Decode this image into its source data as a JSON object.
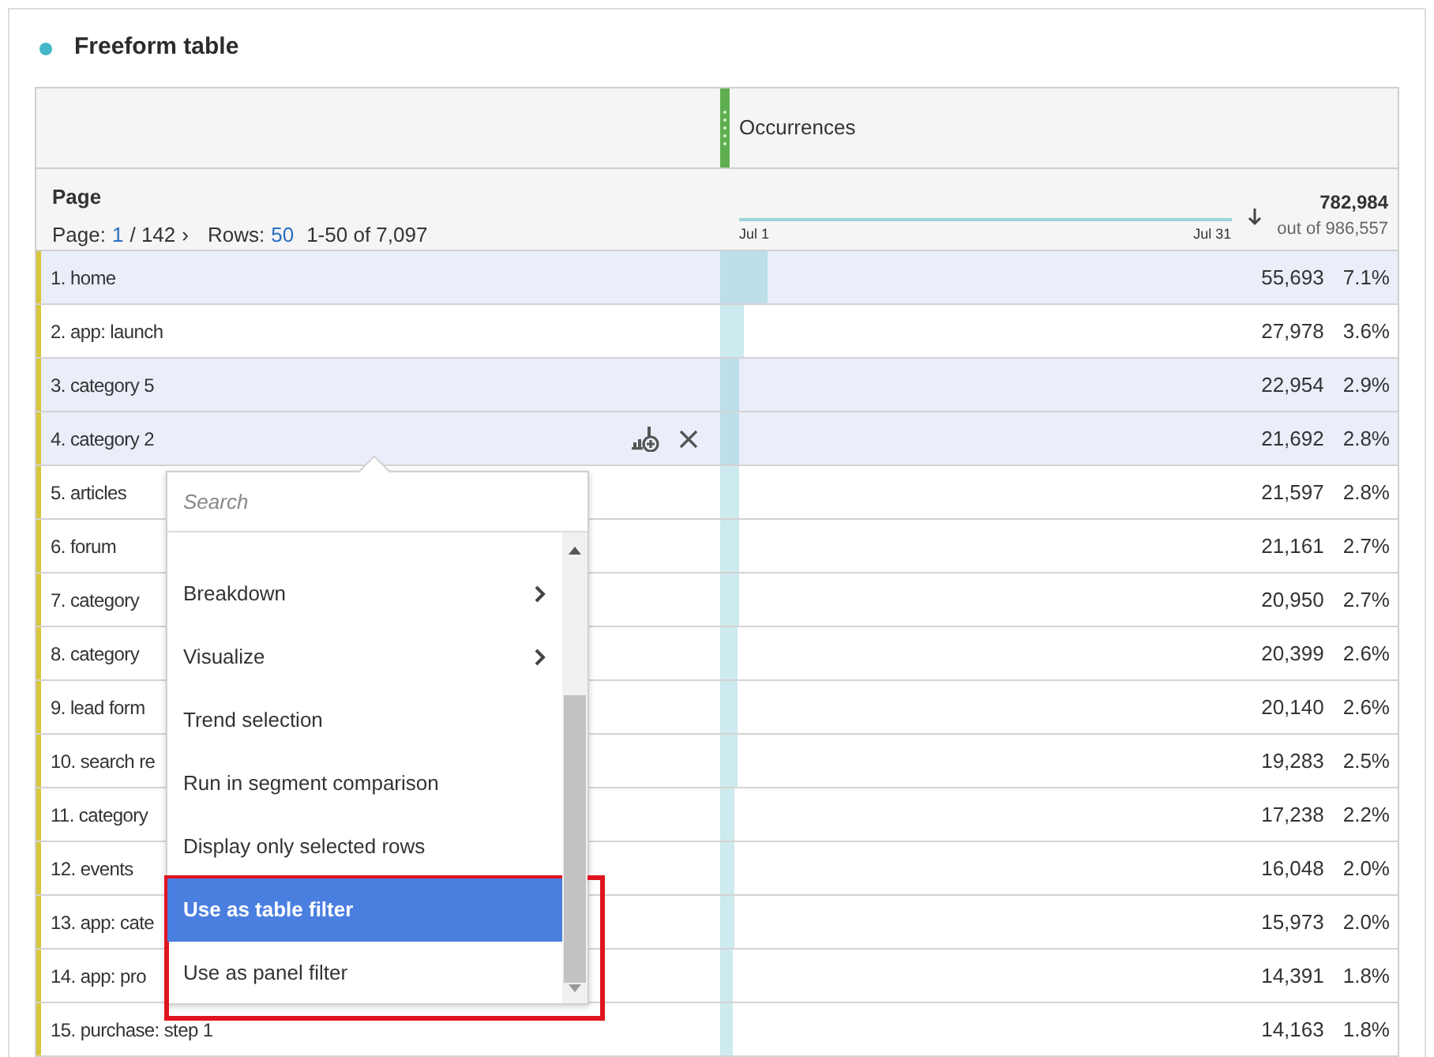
{
  "panel": {
    "title": "Freeform table"
  },
  "table": {
    "metric_header": "Occurrences",
    "dimension_header": "Page",
    "pagination": {
      "page_label": "Page:",
      "page": "1",
      "page_total": "/ 142",
      "next": "›",
      "rows_label": "Rows:",
      "rows": "50",
      "range": "1-50 of 7,097"
    },
    "trend": {
      "start": "Jul 1",
      "end": "Jul 31"
    },
    "total": {
      "value": "782,984",
      "of": "out of 986,557"
    },
    "rows": [
      {
        "label": "1.  home",
        "value": "55,693",
        "percent": "7.1%",
        "level": 0.071,
        "selected": true,
        "actions_shown": false
      },
      {
        "label": "2.  app: launch",
        "value": "27,978",
        "percent": "3.6%",
        "level": 0.036,
        "selected": false,
        "actions_shown": false
      },
      {
        "label": "3.  category 5",
        "value": "22,954",
        "percent": "2.9%",
        "level": 0.029,
        "selected": true,
        "actions_shown": false
      },
      {
        "label": "4.  category 2",
        "value": "21,692",
        "percent": "2.8%",
        "level": 0.028,
        "selected": true,
        "actions_shown": true
      },
      {
        "label": "5.  articles",
        "value": "21,597",
        "percent": "2.8%",
        "level": 0.028,
        "selected": false,
        "actions_shown": false
      },
      {
        "label": "6.  forum",
        "value": "21,161",
        "percent": "2.7%",
        "level": 0.027,
        "selected": false,
        "actions_shown": false
      },
      {
        "label": "7.  category",
        "value": "20,950",
        "percent": "2.7%",
        "level": 0.027,
        "selected": false,
        "actions_shown": false
      },
      {
        "label": "8.  category",
        "value": "20,399",
        "percent": "2.6%",
        "level": 0.026,
        "selected": false,
        "actions_shown": false
      },
      {
        "label": "9.  lead form",
        "value": "20,140",
        "percent": "2.6%",
        "level": 0.026,
        "selected": false,
        "actions_shown": false
      },
      {
        "label": "10.  search re",
        "value": "19,283",
        "percent": "2.5%",
        "level": 0.025,
        "selected": false,
        "actions_shown": false
      },
      {
        "label": "11.  category",
        "value": "17,238",
        "percent": "2.2%",
        "level": 0.022,
        "selected": false,
        "actions_shown": false
      },
      {
        "label": "12.  events",
        "value": "16,048",
        "percent": "2.0%",
        "level": 0.02,
        "selected": false,
        "actions_shown": false
      },
      {
        "label": "13.  app: cate",
        "value": "15,973",
        "percent": "2.0%",
        "level": 0.02,
        "selected": false,
        "actions_shown": false
      },
      {
        "label": "14.  app: pro",
        "value": "14,391",
        "percent": "1.8%",
        "level": 0.018,
        "selected": false,
        "actions_shown": false
      },
      {
        "label": "15.  purchase: step 1",
        "value": "14,163",
        "percent": "1.8%",
        "level": 0.018,
        "selected": false,
        "actions_shown": false
      }
    ]
  },
  "context_menu": {
    "search": {
      "placeholder": "Search"
    },
    "items": [
      {
        "label": "Breakdown",
        "submenu": true,
        "selected": false,
        "framed": false
      },
      {
        "label": "Visualize",
        "submenu": true,
        "selected": false,
        "framed": false
      },
      {
        "label": "Trend selection",
        "submenu": false,
        "selected": false,
        "framed": false
      },
      {
        "label": "Run in segment comparison",
        "submenu": false,
        "selected": false,
        "framed": false
      },
      {
        "label": "Display only selected rows",
        "submenu": false,
        "selected": false,
        "framed": false
      },
      {
        "label": "Use as table filter",
        "submenu": false,
        "selected": true,
        "framed": true
      },
      {
        "label": "Use as panel filter",
        "submenu": false,
        "selected": false,
        "framed": true
      }
    ]
  }
}
